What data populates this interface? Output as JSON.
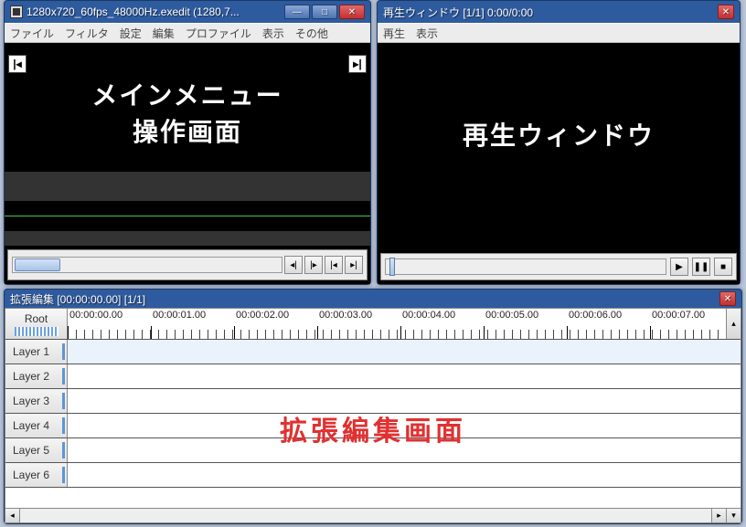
{
  "main_window": {
    "title": "1280x720_60fps_48000Hz.exedit (1280,7...",
    "menu": [
      "ファイル",
      "フィルタ",
      "設定",
      "編集",
      "プロファイル",
      "表示",
      "その他"
    ],
    "overlay_line1": "メインメニュー",
    "overlay_line2": "操作画面"
  },
  "playback_window": {
    "title": "再生ウィンドウ  [1/1]  0:00/0:00",
    "menu": [
      "再生",
      "表示"
    ],
    "overlay": "再生ウィンドウ"
  },
  "timeline_window": {
    "title": "拡張編集 [00:00:00.00] [1/1]",
    "root_label": "Root",
    "ruler_labels": [
      "00:00:00.00",
      "00:00:01.00",
      "00:00:02.00",
      "00:00:03.00",
      "00:00:04.00",
      "00:00:05.00",
      "00:00:06.00",
      "00:00:07.00"
    ],
    "layers": [
      "Layer 1",
      "Layer 2",
      "Layer 3",
      "Layer 4",
      "Layer 5",
      "Layer 6"
    ],
    "overlay": "拡張編集画面"
  }
}
